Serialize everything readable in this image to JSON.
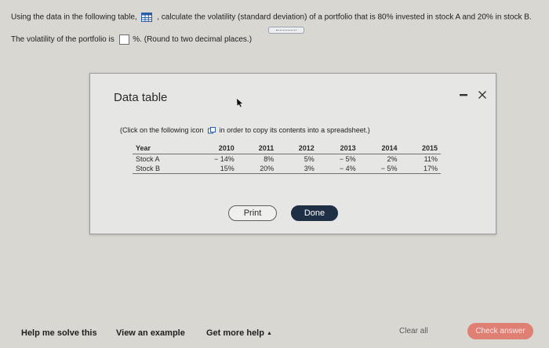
{
  "question": {
    "prefix": "Using the data in the following table,",
    "suffix": ", calculate the volatility (standard deviation) of a portfolio that is 80% invested in stock A and 20% in stock B.",
    "answer_prefix": "The volatility of the portfolio is",
    "answer_suffix": "%. (Round to two decimal places.)",
    "answer_value": ""
  },
  "dialog": {
    "title": "Data table",
    "copy_prefix": "(Click on the following icon",
    "copy_suffix": "in order to copy its contents into a spreadsheet.)",
    "table": {
      "headers": [
        "Year",
        "2010",
        "2011",
        "2012",
        "2013",
        "2014",
        "2015"
      ],
      "rows": [
        [
          "Stock A",
          "− 14%",
          "8%",
          "5%",
          "− 5%",
          "2%",
          "11%"
        ],
        [
          "Stock B",
          "15%",
          "20%",
          "3%",
          "− 4%",
          "− 5%",
          "17%"
        ]
      ]
    },
    "print_label": "Print",
    "done_label": "Done"
  },
  "footer": {
    "help_label": "Help me solve this",
    "example_label": "View an example",
    "more_help_label": "Get more help",
    "clear_label": "Clear all",
    "check_label": "Check answer"
  },
  "colors": {
    "done_button": "#1f2f45",
    "check_answer_button": "#e07f74",
    "page_background": "#d9d7d2",
    "dialog_background": "#e6e6e4"
  },
  "icons": {
    "table": "table-grid-icon",
    "copy": "copy-icon",
    "minimize": "minimize-icon",
    "close": "close-icon",
    "more_help": "caret-up-icon"
  }
}
